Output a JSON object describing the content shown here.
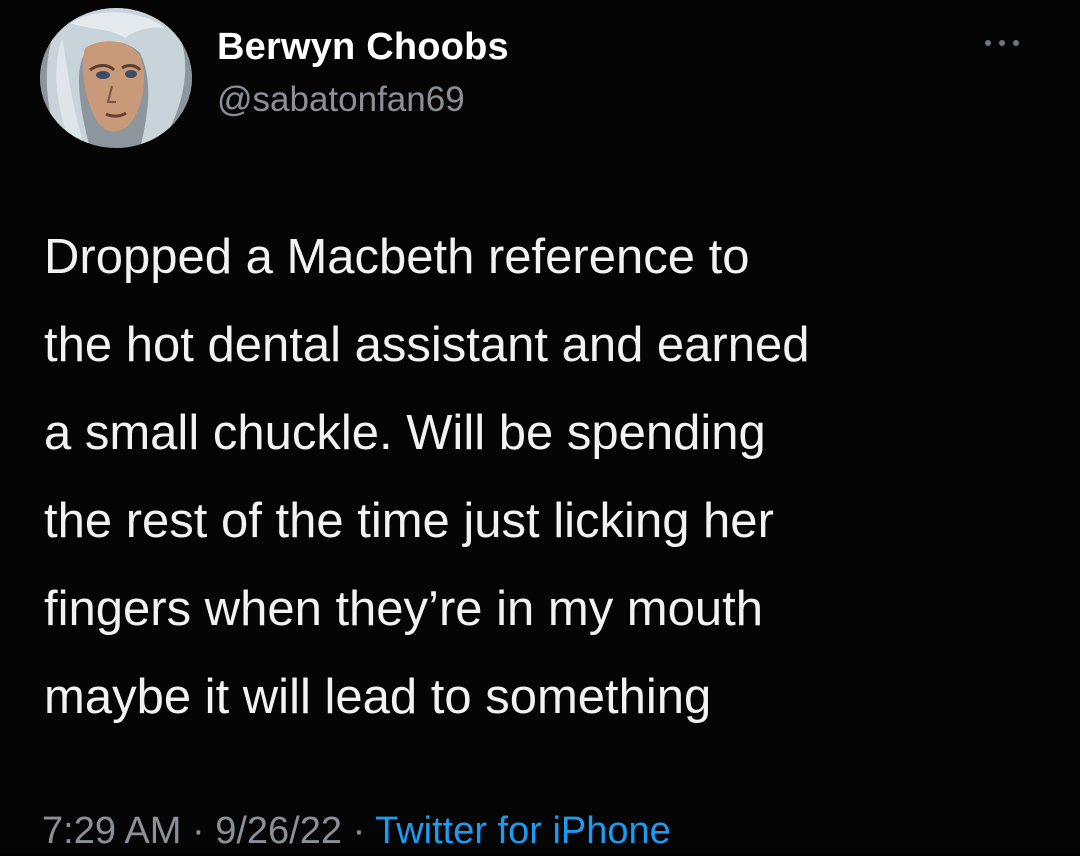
{
  "author": {
    "name": "Berwyn Choobs",
    "handle": "@sabatonfan69"
  },
  "tweet": {
    "lines": [
      "Dropped a Macbeth reference to",
      "the hot dental assistant and earned",
      "a small chuckle. Will be spending",
      "the rest of the time just licking her",
      "fingers when they’re in my mouth",
      "maybe it will lead to something"
    ]
  },
  "meta": {
    "time": "7:29 AM",
    "separator": "·",
    "date": "9/26/22",
    "source": "Twitter for iPhone"
  },
  "icons": {
    "more": "more-horizontal-icon"
  },
  "colors": {
    "background": "#050505",
    "text": "#f2f2f2",
    "secondary": "#8b9197",
    "link": "#1d9bf0"
  }
}
